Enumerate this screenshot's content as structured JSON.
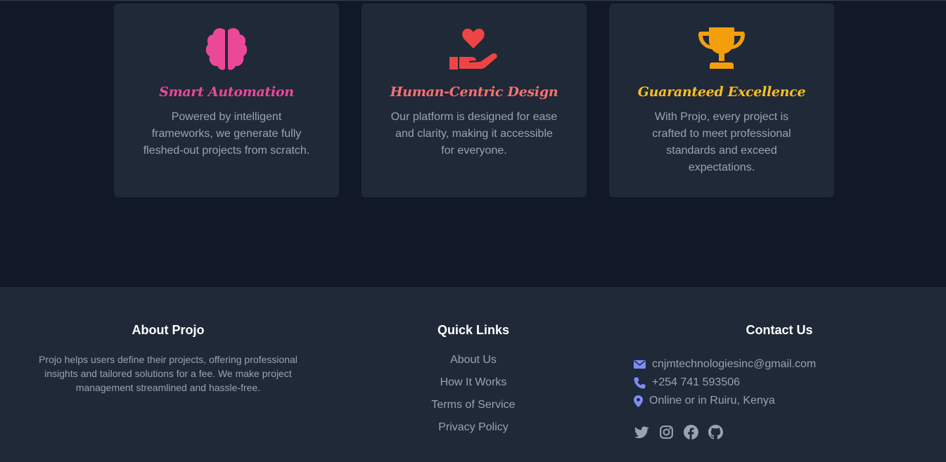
{
  "features": [
    {
      "icon": "brain-icon",
      "title": "Smart Automation",
      "description": "Powered by intelligent frameworks, we generate fully fleshed-out projects from scratch.",
      "color": "#ec4899"
    },
    {
      "icon": "heart-hand-icon",
      "title": "Human-Centric Design",
      "description": "Our platform is designed for ease and clarity, making it accessible for everyone.",
      "color": "#ef4444"
    },
    {
      "icon": "trophy-icon",
      "title": "Guaranteed Excellence",
      "description": "With Projo, every project is crafted to meet professional standards and exceed expectations.",
      "color": "#f59e0b"
    }
  ],
  "footer": {
    "about": {
      "title": "About Projo",
      "text": "Projo helps users define their projects, offering professional insights and tailored solutions for a fee. We make project management streamlined and hassle-free."
    },
    "quick_links": {
      "title": "Quick Links",
      "items": [
        "About Us",
        "How It Works",
        "Terms of Service",
        "Privacy Policy"
      ]
    },
    "contact": {
      "title": "Contact Us",
      "email": "cnjmtechnologiesinc@gmail.com",
      "phone": "+254 741 593506",
      "location": "Online or in Ruiru, Kenya",
      "icon_color": "#818cf8",
      "social_icons": [
        "twitter-icon",
        "instagram-icon",
        "facebook-icon",
        "github-icon"
      ]
    }
  }
}
